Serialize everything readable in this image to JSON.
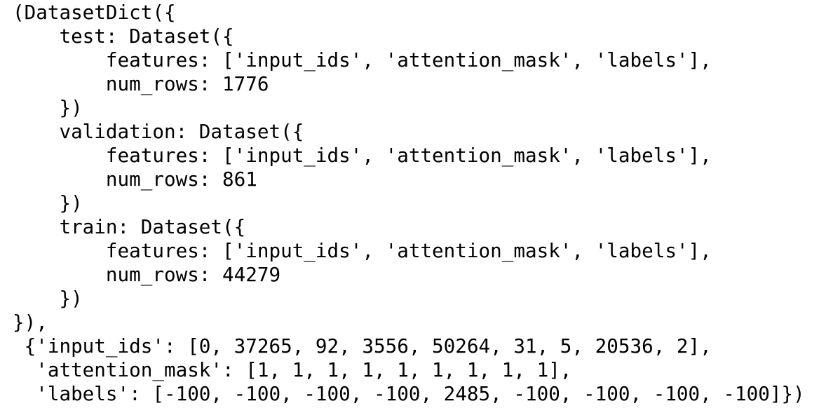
{
  "output": {
    "lines": [
      "(DatasetDict({",
      "    test: Dataset({",
      "        features: ['input_ids', 'attention_mask', 'labels'],",
      "        num_rows: 1776",
      "    })",
      "    validation: Dataset({",
      "        features: ['input_ids', 'attention_mask', 'labels'],",
      "        num_rows: 861",
      "    })",
      "    train: Dataset({",
      "        features: ['input_ids', 'attention_mask', 'labels'],",
      "        num_rows: 44279",
      "    })",
      "}),",
      " {'input_ids': [0, 37265, 92, 3556, 50264, 31, 5, 20536, 2],",
      "  'attention_mask': [1, 1, 1, 1, 1, 1, 1, 1, 1],",
      "  'labels': [-100, -100, -100, -100, 2485, -100, -100, -100, -100]})"
    ]
  }
}
